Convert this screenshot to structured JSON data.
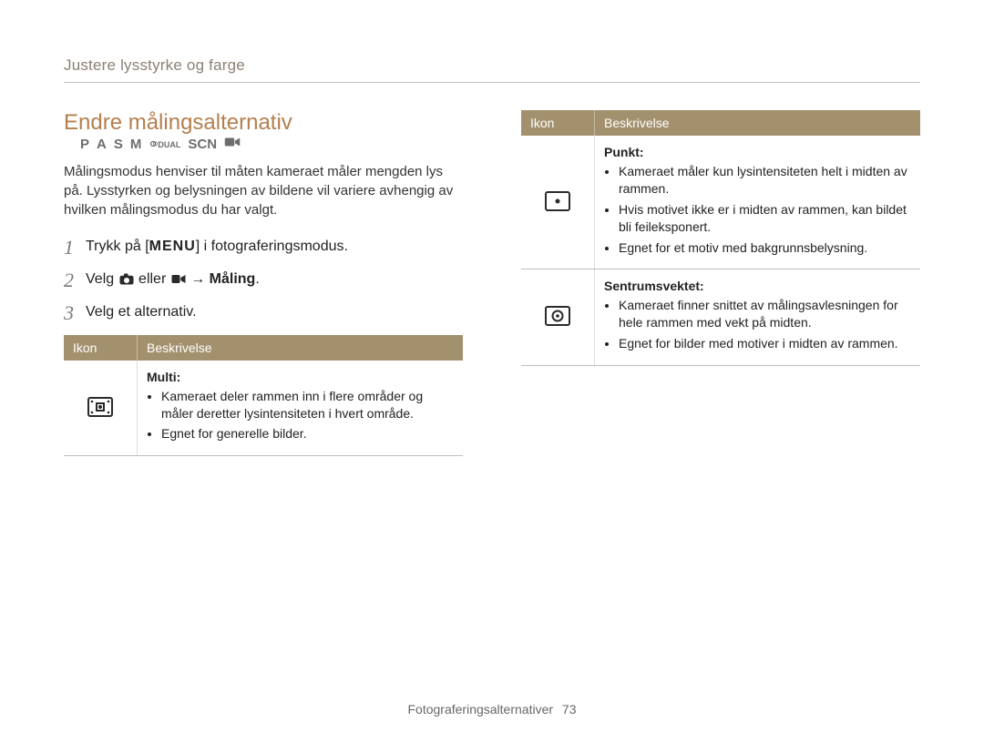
{
  "breadcrumb": "Justere lysstyrke og farge",
  "section": {
    "title": "Endre målingsalternativ",
    "modes": [
      "P",
      "A",
      "S",
      "M",
      "DUAL",
      "SCN",
      "movie"
    ],
    "intro": "Målingsmodus henviser til måten kameraet måler mengden lys på. Lysstyrken og belysningen av bildene vil variere avhengig av hvilken målingsmodus du har valgt."
  },
  "steps": [
    {
      "num": "1",
      "pre": "Trykk på [",
      "key": "MENU",
      "post": "] i fotograferingsmodus."
    },
    {
      "num": "2",
      "pre": "Velg ",
      "mid": " eller ",
      "arrow": " → ",
      "target": "Måling",
      "post": "."
    },
    {
      "num": "3",
      "text": "Velg et alternativ."
    }
  ],
  "table_headers": {
    "icon": "Ikon",
    "desc": "Beskrivelse"
  },
  "left_table": [
    {
      "icon": "multi-metering-icon",
      "title": "Multi",
      "colon": ":",
      "bullets": [
        "Kameraet deler rammen inn i flere områder og måler deretter lysintensiteten i hvert område.",
        "Egnet for generelle bilder."
      ]
    }
  ],
  "right_table": [
    {
      "icon": "spot-metering-icon",
      "title": "Punkt",
      "colon": ":",
      "bullets": [
        "Kameraet måler kun lysintensiteten helt i midten av rammen.",
        "Hvis motivet ikke er i midten av rammen, kan bildet bli feileksponert.",
        "Egnet for et motiv med bakgrunnsbelysning."
      ]
    },
    {
      "icon": "center-weighted-metering-icon",
      "title": "Sentrumsvektet",
      "colon": ":",
      "bullets": [
        "Kameraet finner snittet av målingsavlesningen for hele rammen med vekt på midten.",
        "Egnet for bilder med motiver i midten av rammen."
      ]
    }
  ],
  "footer": {
    "label": "Fotograferingsalternativer",
    "page": "73"
  }
}
